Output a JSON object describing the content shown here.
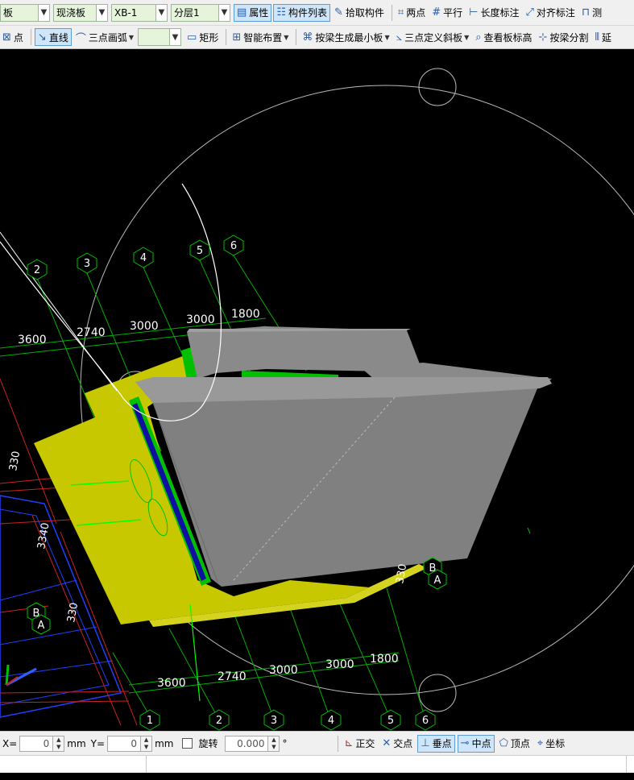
{
  "toolbar1": {
    "combo_category": "板",
    "combo_type": "现浇板",
    "combo_name": "XB-1",
    "combo_layer": "分层1",
    "btn_properties": "属性",
    "btn_component_list": "构件列表",
    "btn_pick": "拾取构件",
    "btn_two_point": "两点",
    "btn_parallel": "平行",
    "btn_length_dim": "长度标注",
    "btn_align_dim": "对齐标注",
    "btn_measure": "测"
  },
  "toolbar2": {
    "btn_point": "点",
    "btn_line": "直线",
    "btn_arc": "三点画弧",
    "btn_rect": "矩形",
    "btn_smart": "智能布置",
    "btn_beam_slab": "按梁生成最小板",
    "btn_slope": "三点定义斜板",
    "btn_view_height": "查看板标高",
    "btn_beam_split": "按梁分割",
    "btn_extend": "延"
  },
  "axes": {
    "top_numbers": [
      "2",
      "3",
      "4",
      "5",
      "6"
    ],
    "top_dims": [
      "3600",
      "2740",
      "3000",
      "3000",
      "1800"
    ],
    "bottom_numbers": [
      "1",
      "2",
      "3",
      "4",
      "5",
      "6"
    ],
    "bottom_dims": [
      "3600",
      "2740",
      "3000",
      "3000",
      "1800"
    ],
    "left_dims": [
      "330",
      "3340",
      "330"
    ],
    "right_dim": "330",
    "letters": [
      "B",
      "A",
      "B",
      "A"
    ]
  },
  "status": {
    "x_label": "X=",
    "x_value": "0",
    "x_unit": "mm",
    "y_label": "Y=",
    "y_value": "0",
    "y_unit": "mm",
    "rotate_label": "旋转",
    "rotate_value": "0.000",
    "degree": "°",
    "btn_ortho": "正交",
    "btn_intersect": "交点",
    "btn_perp": "垂点",
    "btn_mid": "中点",
    "btn_vertex": "顶点",
    "btn_coord": "坐标"
  },
  "colors": {
    "slab_yellow": "#c8c800",
    "slab_gray": "#808080",
    "axis_green": "#00c000",
    "beam_blue": "#1010a0",
    "grid_red": "#cc2020"
  }
}
